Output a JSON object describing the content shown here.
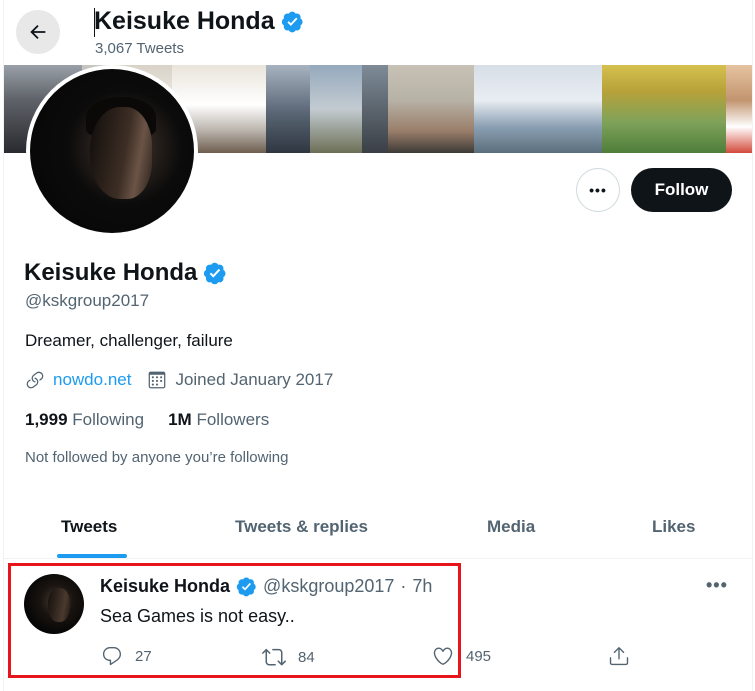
{
  "header": {
    "name": "Keisuke Honda",
    "tweet_count": "3,067 Tweets",
    "back_icon": "arrow-left-icon"
  },
  "profile": {
    "name": "Keisuke Honda",
    "handle": "@kskgroup2017",
    "bio": "Dreamer, challenger, failure",
    "website": "nowdo.net",
    "joined": "Joined January 2017",
    "following_count": "1,999",
    "following_label": "Following",
    "followers_count": "1M",
    "followers_label": "Followers",
    "not_followed": "Not followed by anyone you’re following",
    "more_label": "•••",
    "follow_label": "Follow"
  },
  "tabs": [
    {
      "label": "Tweets",
      "active": true
    },
    {
      "label": "Tweets & replies",
      "active": false
    },
    {
      "label": "Media",
      "active": false
    },
    {
      "label": "Likes",
      "active": false
    }
  ],
  "tweet": {
    "name": "Keisuke Honda",
    "handle": "@kskgroup2017",
    "separator": "·",
    "time": "7h",
    "text": "Sea Games is not easy..",
    "replies": "27",
    "retweets": "84",
    "likes": "495",
    "more": "•••"
  },
  "colors": {
    "accent": "#1d9bf0",
    "verified": "#1d9bf0",
    "highlight": "#e8141b",
    "text": "#0f1419",
    "muted": "#536471"
  }
}
